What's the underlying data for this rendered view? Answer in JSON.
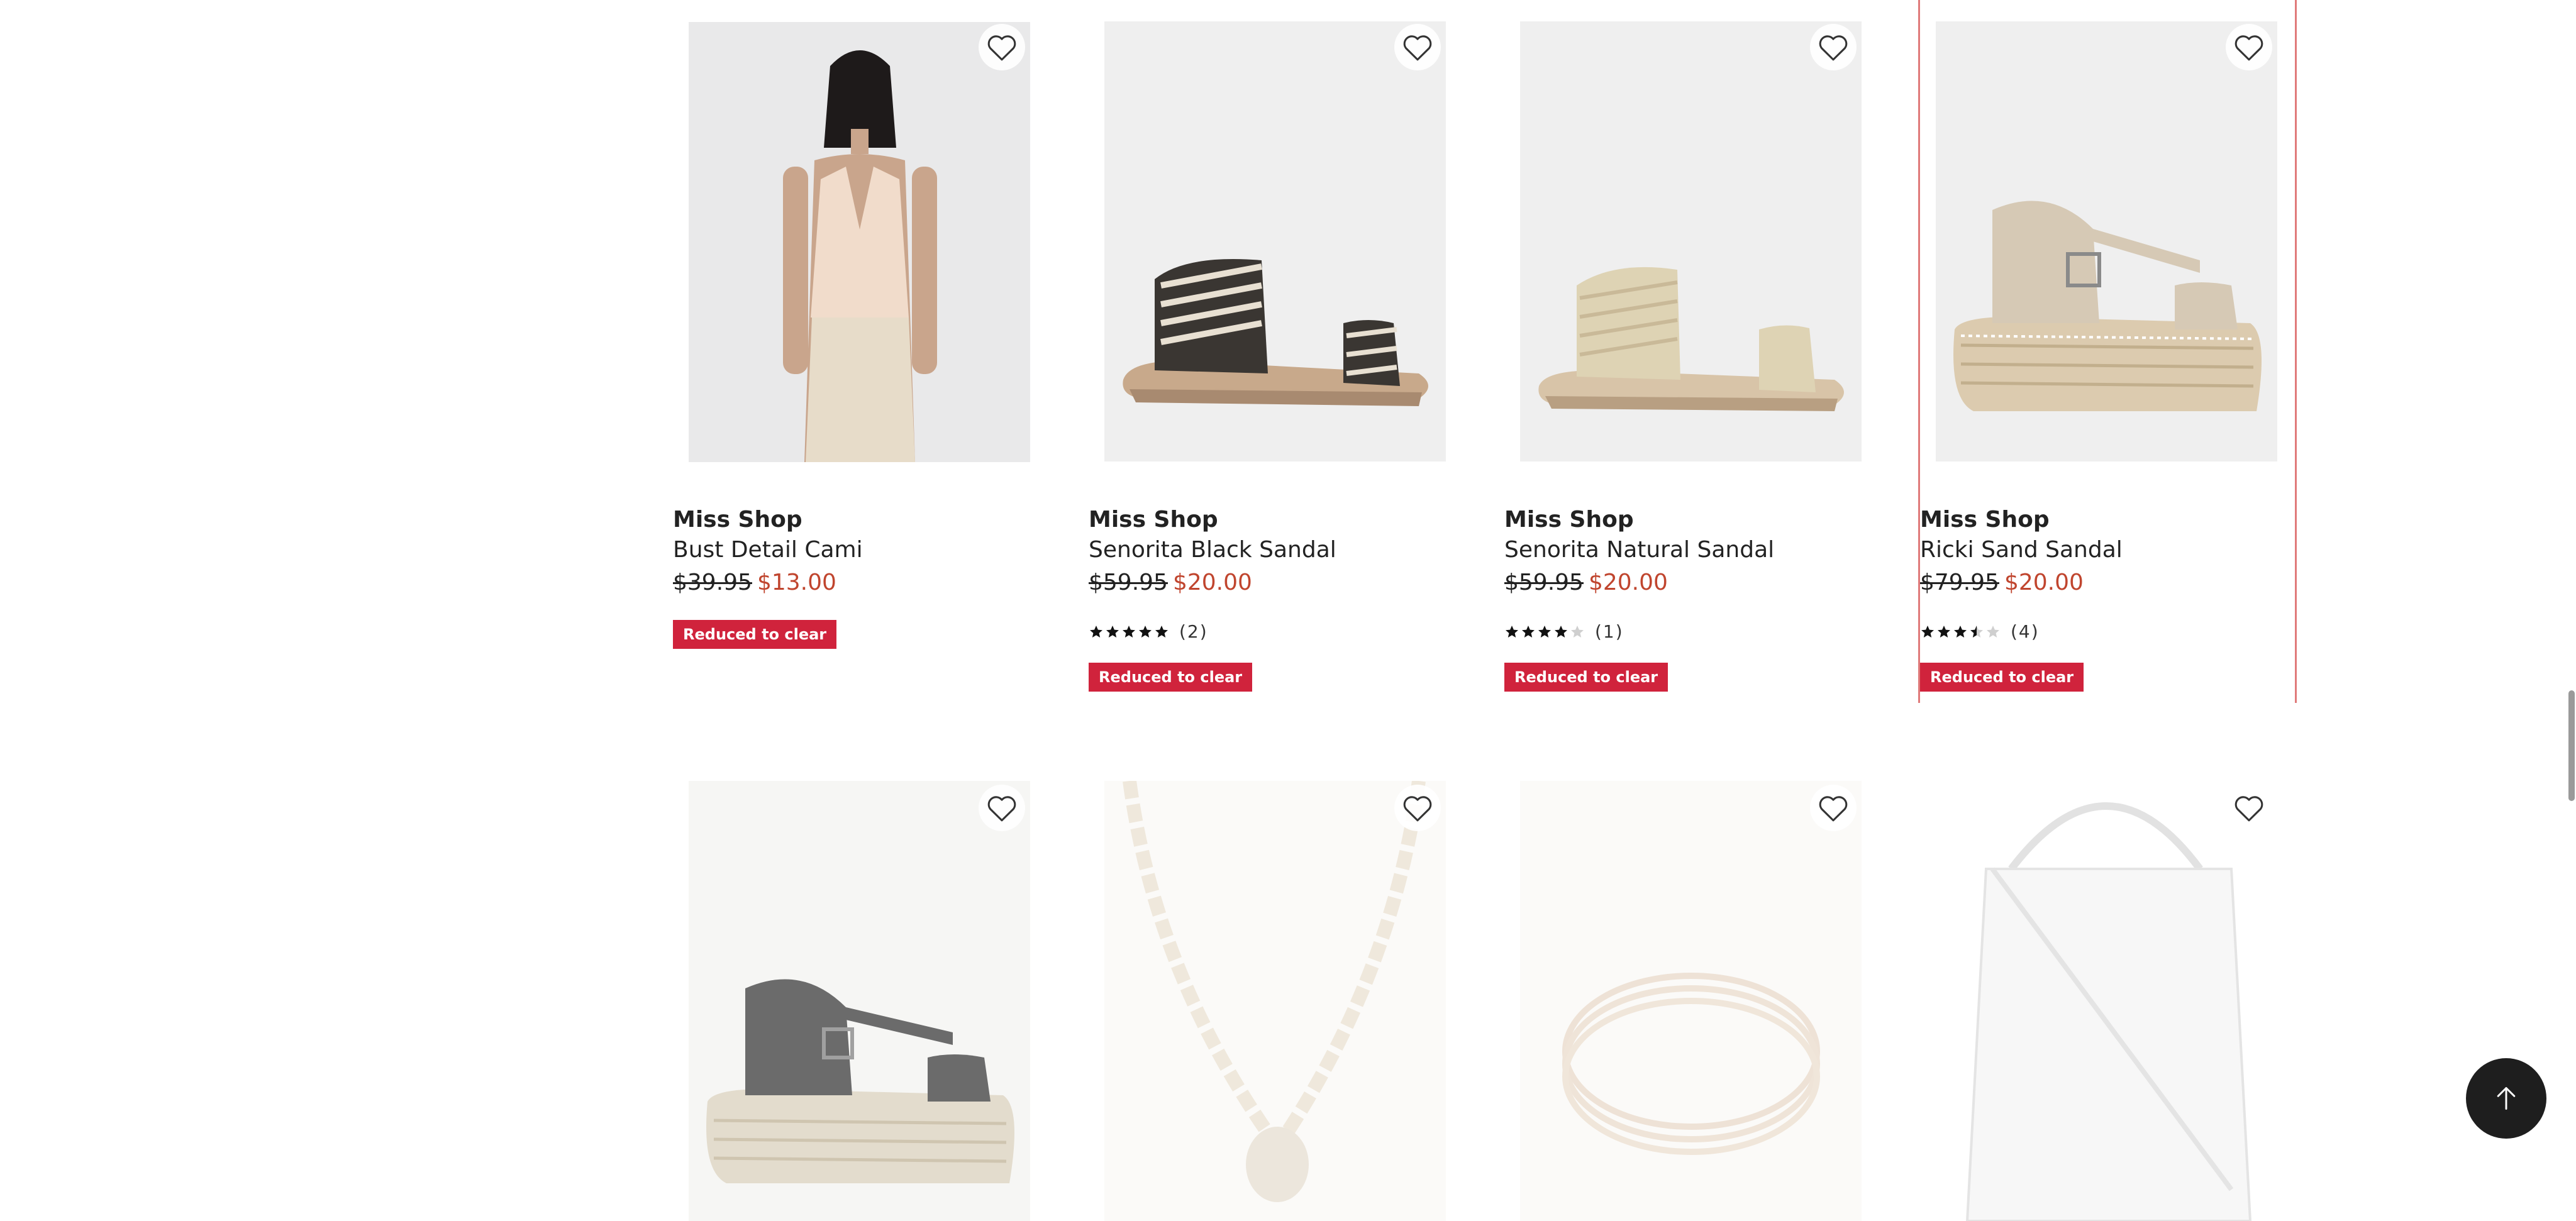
{
  "colors": {
    "badge_bg": "#d0233c",
    "sale_price": "#c0452e",
    "selection_outline": "#e07a7a",
    "back_to_top_bg": "#1e1e1e"
  },
  "icons": {
    "wishlist": "heart-outline-icon",
    "back_to_top": "arrow-up-icon",
    "rating": "star-icon"
  },
  "products": [
    {
      "brand": "Miss Shop",
      "name": "Bust Detail Cami",
      "was_price": "$39.95",
      "price": "$13.00",
      "rating": null,
      "review_count": null,
      "badge": "Reduced to clear"
    },
    {
      "brand": "Miss Shop",
      "name": "Senorita Black Sandal",
      "was_price": "$59.95",
      "price": "$20.00",
      "rating": 5,
      "review_count": "(2)",
      "badge": "Reduced to clear"
    },
    {
      "brand": "Miss Shop",
      "name": "Senorita Natural Sandal",
      "was_price": "$59.95",
      "price": "$20.00",
      "rating": 4,
      "review_count": "(1)",
      "badge": "Reduced to clear"
    },
    {
      "brand": "Miss Shop",
      "name": "Ricki Sand Sandal",
      "was_price": "$79.95",
      "price": "$20.00",
      "rating": 3.5,
      "review_count": "(4)",
      "badge": "Reduced to clear"
    }
  ]
}
